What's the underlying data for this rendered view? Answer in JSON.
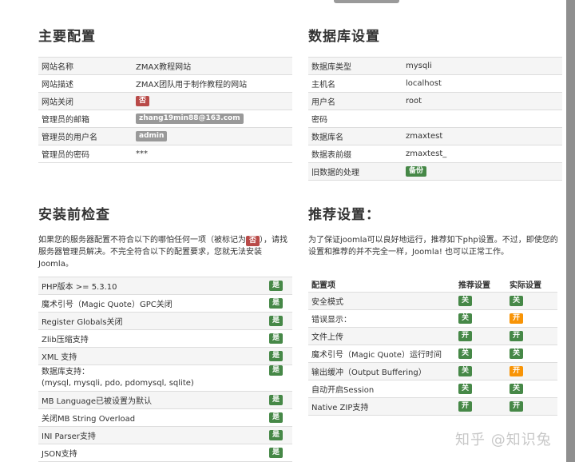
{
  "main_config": {
    "title": "主要配置",
    "rows": [
      {
        "label": "网站名称",
        "value": "ZMAX教程网站"
      },
      {
        "label": "网站描述",
        "value": "ZMAX团队用于制作教程的网站"
      },
      {
        "label": "网站关闭",
        "badge": "否",
        "badge_color": "#b94a48"
      },
      {
        "label": "管理员的邮箱",
        "badge": "zhang19min88@163.com",
        "badge_color": "#999999"
      },
      {
        "label": "管理员的用户名",
        "badge": "admin",
        "badge_color": "#999999"
      },
      {
        "label": "管理员的密码",
        "value": "***"
      }
    ]
  },
  "db_config": {
    "title": "数据库设置",
    "rows": [
      {
        "label": "数据库类型",
        "value": "mysqli"
      },
      {
        "label": "主机名",
        "value": "localhost"
      },
      {
        "label": "用户名",
        "value": "root"
      },
      {
        "label": "密码",
        "value": ""
      },
      {
        "label": "数据库名",
        "value": "zmaxtest"
      },
      {
        "label": "数据表前缀",
        "value": "zmaxtest_"
      },
      {
        "label": "旧数据的处理",
        "badge": "备份",
        "badge_color": "#468847"
      }
    ]
  },
  "precheck": {
    "title": "安装前检查",
    "desc_part1": "如果您的服务器配置不符合以下的哪怕任何一项（被标记为",
    "desc_badge": "否",
    "desc_part2": "），请找服务器管理员解决。不完全符合以下的配置要求，您就无法安装Joomla。",
    "rows": [
      {
        "label": "PHP版本 >= 5.3.10",
        "badge": "是"
      },
      {
        "label": "魔术引号（Magic Quote）GPC关闭",
        "badge": "是"
      },
      {
        "label": "Register Globals关闭",
        "badge": "是"
      },
      {
        "label": "Zlib压缩支持",
        "badge": "是"
      },
      {
        "label": "XML 支持",
        "badge": "是"
      },
      {
        "label": "数据库支持：",
        "label2": "(mysql, mysqli, pdo, pdomysql, sqlite)",
        "badge": "是"
      },
      {
        "label": "MB Language已被设置为默认",
        "badge": "是"
      },
      {
        "label": "关闭MB String Overload",
        "badge": "是"
      },
      {
        "label": "INI Parser支持",
        "badge": "是"
      },
      {
        "label": "JSON支持",
        "badge": "是"
      }
    ]
  },
  "recommended": {
    "title": "推荐设置：",
    "desc": "为了保证joomla可以良好地运行，推荐如下php设置。不过，即使您的设置和推荐的并不完全一样，Joomla! 也可以正常工作。",
    "headers": [
      "配置项",
      "推荐设置",
      "实际设置"
    ],
    "rows": [
      {
        "label": "安全模式",
        "rec": "关",
        "rec_color": "#468847",
        "act": "关",
        "act_color": "#468847"
      },
      {
        "label": "错误显示：",
        "rec": "关",
        "rec_color": "#468847",
        "act": "开",
        "act_color": "#f89406"
      },
      {
        "label": "文件上传",
        "rec": "开",
        "rec_color": "#468847",
        "act": "开",
        "act_color": "#468847"
      },
      {
        "label": "魔术引号（Magic Quote）运行时间",
        "rec": "关",
        "rec_color": "#468847",
        "act": "关",
        "act_color": "#468847"
      },
      {
        "label": "输出缓冲（Output Buffering）",
        "rec": "关",
        "rec_color": "#468847",
        "act": "开",
        "act_color": "#f89406"
      },
      {
        "label": "自动开启Session",
        "rec": "关",
        "rec_color": "#468847",
        "act": "关",
        "act_color": "#468847"
      },
      {
        "label": "Native ZIP支持",
        "rec": "开",
        "rec_color": "#468847",
        "act": "开",
        "act_color": "#468847"
      }
    ]
  },
  "watermark": "知乎 @知识兔"
}
